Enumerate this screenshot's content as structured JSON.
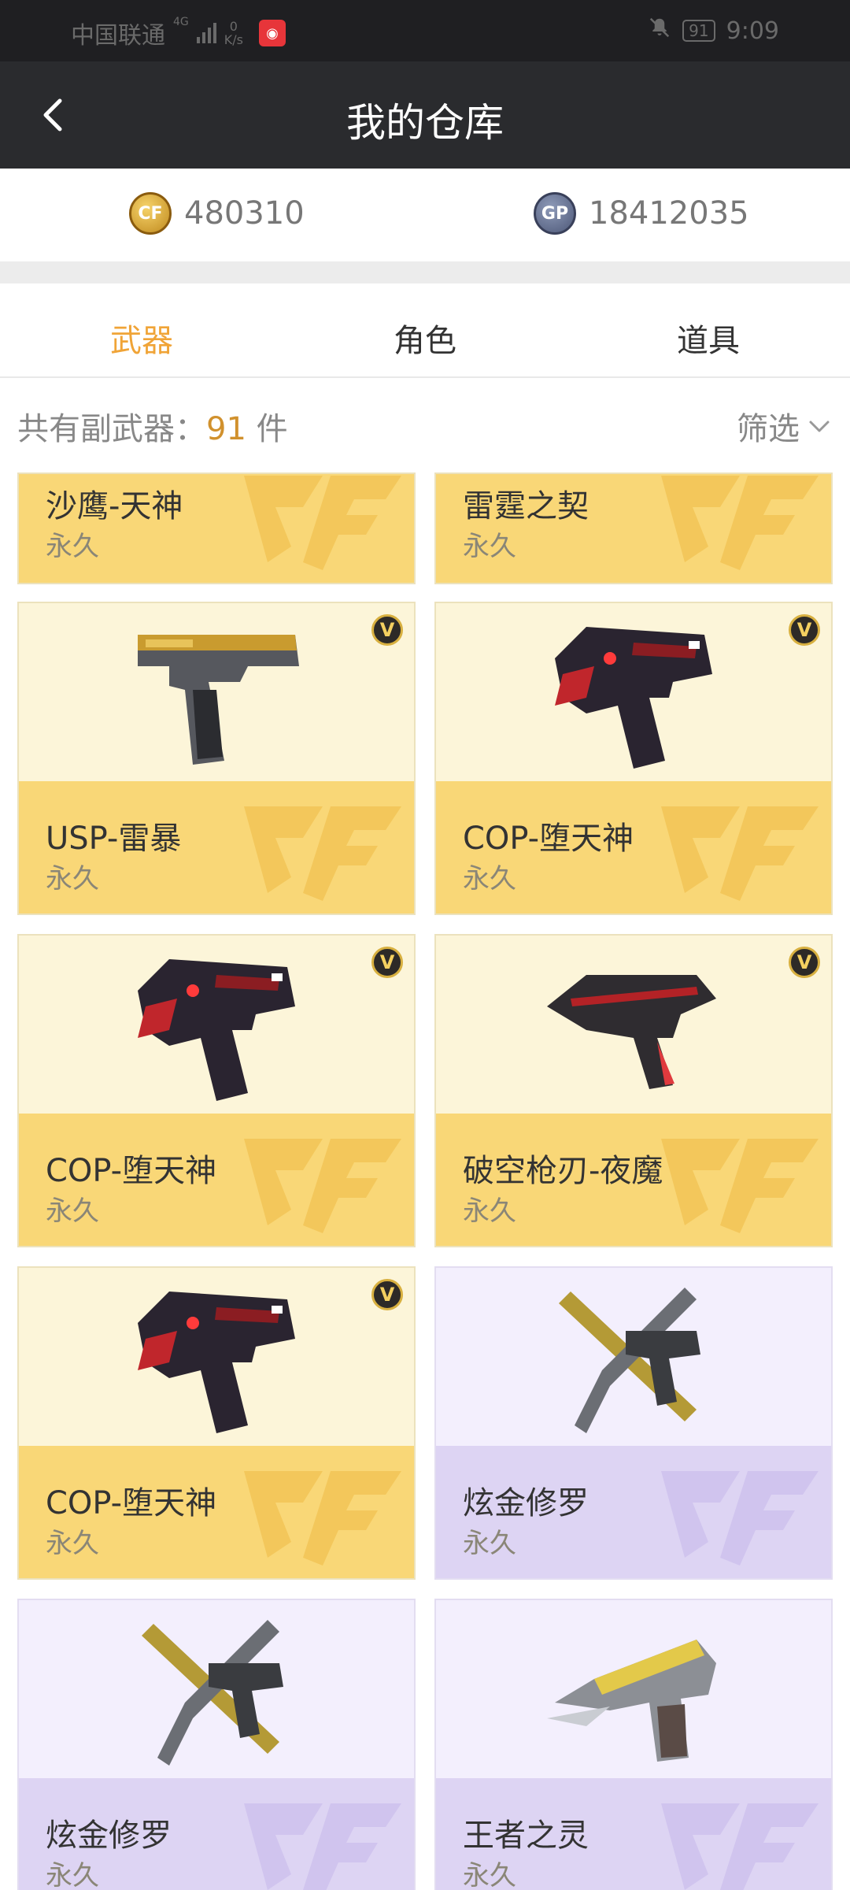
{
  "status_bar": {
    "carrier": "中国联通",
    "network": "4G",
    "speed_value": "0",
    "speed_unit": "K/s",
    "battery": "91",
    "time": "9:09"
  },
  "nav": {
    "title": "我的仓库"
  },
  "balances": [
    {
      "icon": "cf-coin-icon",
      "icon_text": "CF",
      "value": "480310"
    },
    {
      "icon": "gp-coin-icon",
      "icon_text": "GP",
      "value": "18412035"
    }
  ],
  "tabs": [
    {
      "label": "武器",
      "active": true
    },
    {
      "label": "角色",
      "active": false
    },
    {
      "label": "道具",
      "active": false
    }
  ],
  "count": {
    "prefix": "共有副武器：",
    "number": "91",
    "suffix": " 件"
  },
  "filter": {
    "label": "筛选"
  },
  "vip_badge": "V",
  "items": [
    {
      "name": "沙鹰-天神",
      "duration": "永久",
      "theme": "gold",
      "vip": false
    },
    {
      "name": "雷霆之契",
      "duration": "永久",
      "theme": "gold",
      "vip": false
    },
    {
      "name": "USP-雷暴",
      "duration": "永久",
      "theme": "gold",
      "vip": true,
      "gun": "usp"
    },
    {
      "name": "COP-堕天神",
      "duration": "永久",
      "theme": "gold",
      "vip": true,
      "gun": "cop"
    },
    {
      "name": "COP-堕天神",
      "duration": "永久",
      "theme": "gold",
      "vip": true,
      "gun": "cop"
    },
    {
      "name": "破空枪刃-夜魔",
      "duration": "永久",
      "theme": "gold",
      "vip": true,
      "gun": "blade"
    },
    {
      "name": "COP-堕天神",
      "duration": "永久",
      "theme": "gold",
      "vip": true,
      "gun": "cop"
    },
    {
      "name": "炫金修罗",
      "duration": "永久",
      "theme": "purple",
      "vip": false,
      "gun": "xblade"
    },
    {
      "name": "炫金修罗",
      "duration": "永久",
      "theme": "purple",
      "vip": false,
      "gun": "xblade"
    },
    {
      "name": "王者之灵",
      "duration": "永久",
      "theme": "purple",
      "vip": false,
      "gun": "deagle"
    }
  ]
}
